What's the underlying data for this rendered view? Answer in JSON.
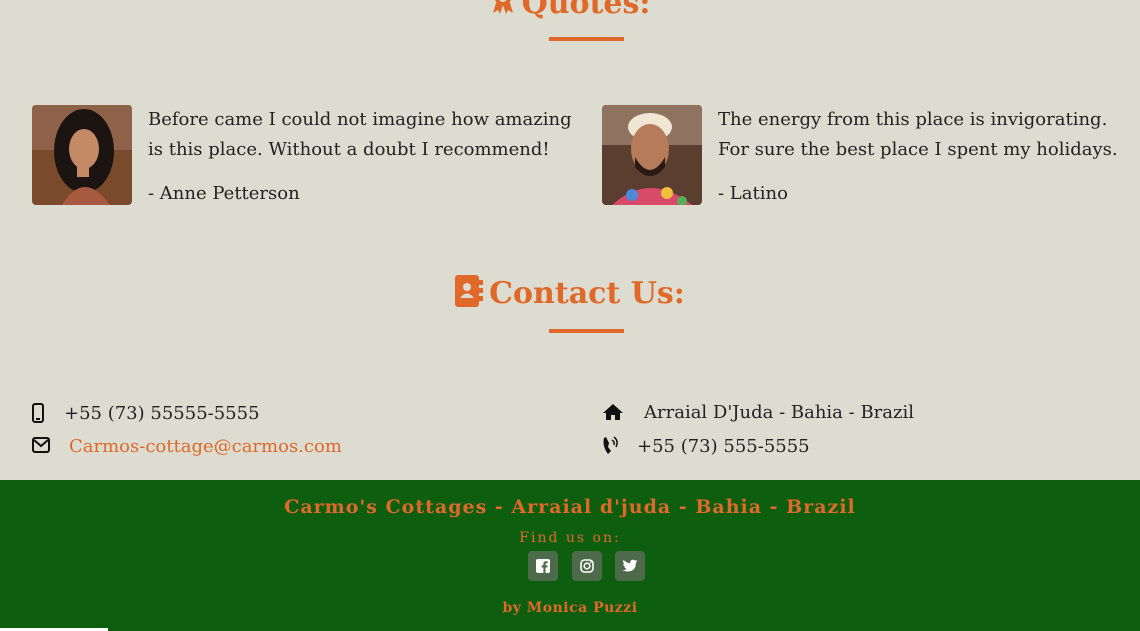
{
  "quotes": {
    "title": "Quotes:",
    "icon": "award-icon",
    "items": [
      {
        "text": "Before came I could not imagine how amazing is this place. Without a doubt I recommend!",
        "author": "- Anne Petterson",
        "avatar": "avatar-woman"
      },
      {
        "text": "The energy from this place is invigorating. For sure the best place I spent my holidays.",
        "author": "- Latino",
        "avatar": "avatar-man"
      }
    ]
  },
  "contact": {
    "title": "Contact Us:",
    "icon": "address-book-icon",
    "mobile": "+55 (73) 55555-5555",
    "email": "Carmos-cottage@carmos.com",
    "address": "Arraial D'Juda - Bahia - Brazil",
    "phone": "+55 (73) 555-5555"
  },
  "footer": {
    "title": "Carmo's Cottages - Arraial d'juda - Bahia - Brazil",
    "find_us": "Find us on:",
    "social": [
      "facebook-icon",
      "instagram-icon",
      "twitter-icon"
    ],
    "byline": "by Monica Puzzi"
  },
  "colors": {
    "accent": "#e0692a",
    "background": "#dcdcd0",
    "footer": "#0e5e10",
    "social_bg": "#4d6a4b"
  }
}
